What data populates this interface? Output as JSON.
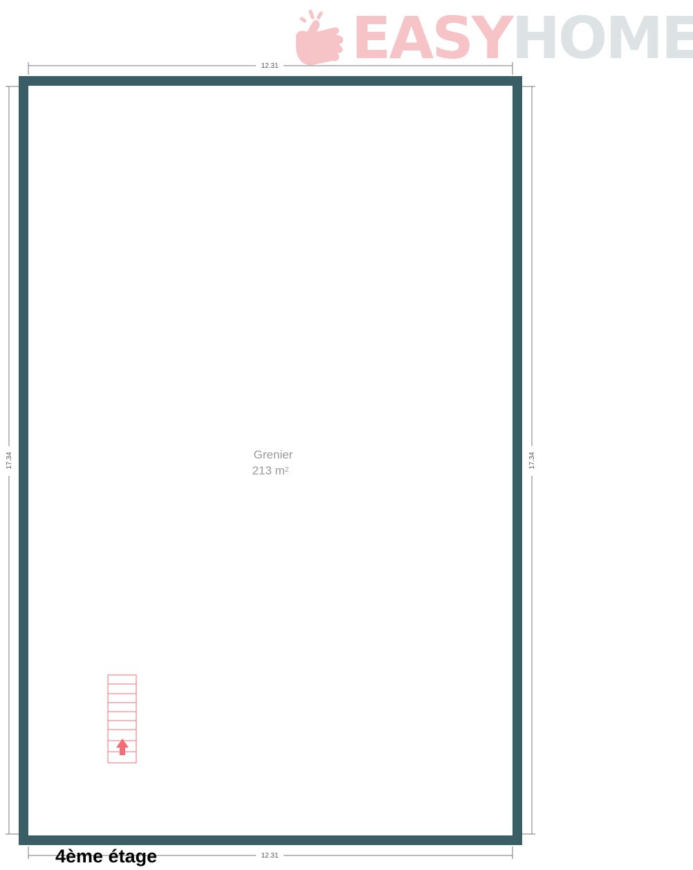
{
  "logo": {
    "part1": "EASY",
    "part2": "HOME",
    "icon": "hand-icon",
    "colors": {
      "part1": "#f6c3c6",
      "part2": "#dde2e5"
    }
  },
  "dimensions": {
    "top": "12.31",
    "bottom": "12.31",
    "left": "17.34",
    "right": "17.34"
  },
  "room": {
    "name": "Grenier",
    "area": "213 m",
    "area_unit_sup": "2"
  },
  "floor": {
    "label": "4ème étage"
  },
  "colors": {
    "wall": "#3a5e66",
    "stairs": "#f26d78",
    "dimension_line": "#666666"
  }
}
